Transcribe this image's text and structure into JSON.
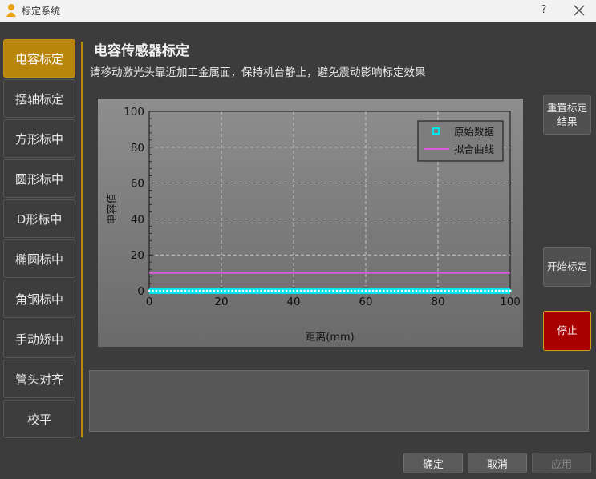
{
  "window": {
    "title": "标定系统",
    "help_label": "?"
  },
  "sidebar": {
    "items": [
      {
        "label": "电容标定",
        "active": true
      },
      {
        "label": "摆轴标定",
        "active": false
      },
      {
        "label": "方形标中",
        "active": false
      },
      {
        "label": "圆形标中",
        "active": false
      },
      {
        "label": "D形标中",
        "active": false
      },
      {
        "label": "椭圆标中",
        "active": false
      },
      {
        "label": "角钢标中",
        "active": false
      },
      {
        "label": "手动矫中",
        "active": false
      },
      {
        "label": "管头对齐",
        "active": false
      },
      {
        "label": "校平",
        "active": false
      }
    ]
  },
  "main": {
    "title": "电容传感器标定",
    "subtitle": "请移动激光头靠近加工金属面，保持机台静止，避免震动影响标定效果"
  },
  "actions": {
    "reset_line1": "重置标定",
    "reset_line2": "结果",
    "start_label": "开始标定",
    "stop_label": "停止"
  },
  "footer": {
    "ok_label": "确定",
    "cancel_label": "取消",
    "apply_label": "应用"
  },
  "colors": {
    "accent": "#b8860b",
    "stop": "#a80000",
    "raw_data": "#00e5ee",
    "fit_curve": "#e05ae0"
  },
  "chart_data": {
    "type": "line",
    "xlabel": "距离(mm)",
    "ylabel": "电容值",
    "xlim": [
      0,
      100
    ],
    "ylim": [
      0,
      100
    ],
    "x_ticks": [
      "0",
      "20",
      "40",
      "60",
      "80",
      "100"
    ],
    "y_ticks": [
      "0",
      "20",
      "40",
      "60",
      "80",
      "100"
    ],
    "grid": true,
    "legend_position": "top-right",
    "series": [
      {
        "name": "原始数据",
        "style": "markers",
        "color": "#00e5ee",
        "x": [
          0,
          100
        ],
        "y": [
          0,
          0
        ]
      },
      {
        "name": "拟合曲线",
        "style": "line",
        "color": "#e05ae0",
        "x": [
          0,
          100
        ],
        "y": [
          10,
          10
        ]
      }
    ]
  }
}
